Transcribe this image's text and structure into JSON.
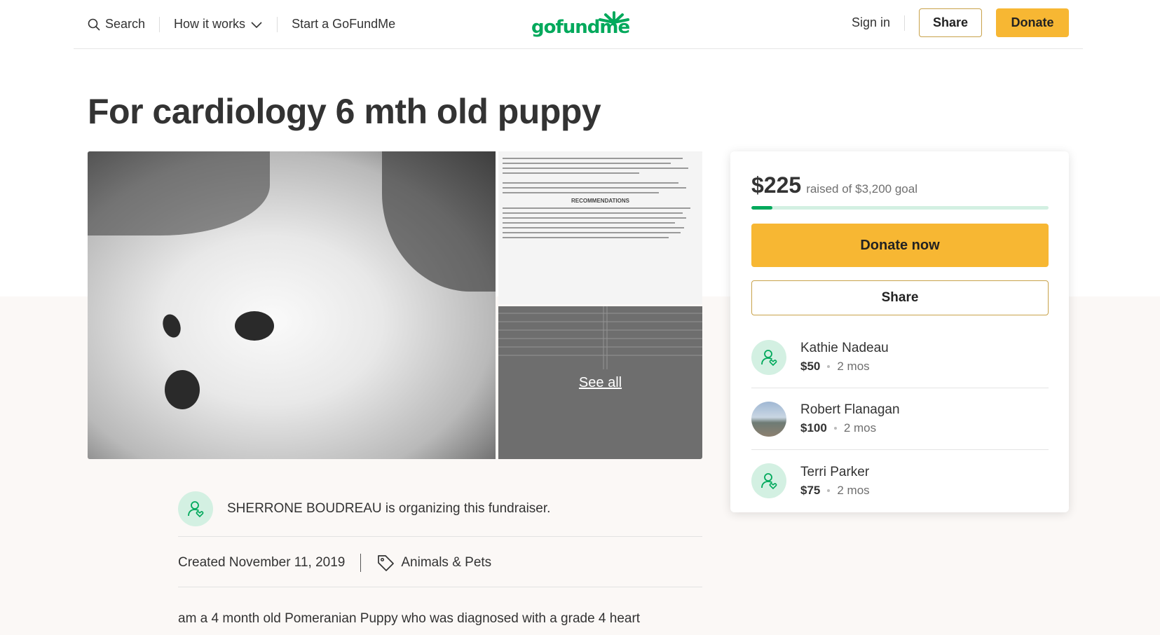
{
  "header": {
    "search_label": "Search",
    "how_it_works_label": "How it works",
    "start_label": "Start a GoFundMe",
    "logo_text": "gofundme",
    "signin_label": "Sign in",
    "share_label": "Share",
    "donate_label": "Donate"
  },
  "campaign": {
    "title": "For cardiology 6 mth old puppy",
    "see_all_label": "See all",
    "document_heading": "RECOMMENDATIONS",
    "organizer_text": "SHERRONE BOUDREAU is organizing this fundraiser.",
    "created": "Created November 11, 2019",
    "category": "Animals & Pets",
    "story_start": "am a 4 month old Pomeranian Puppy who was diagnosed with a grade 4 heart"
  },
  "donation_card": {
    "raised_amount": "$225",
    "goal_text": "raised of $3,200 goal",
    "progress_fraction": 0.07,
    "donate_now_label": "Donate now",
    "share_label": "Share",
    "donors": [
      {
        "name": "Kathie Nadeau",
        "amount": "$50",
        "time": "2 mos"
      },
      {
        "name": "Robert Flanagan",
        "amount": "$100",
        "time": "2 mos"
      },
      {
        "name": "Terri Parker",
        "amount": "$75",
        "time": "2 mos"
      }
    ]
  },
  "colors": {
    "brand_green": "#02a95c",
    "donate_yellow": "#f7b733",
    "light_green": "#d3f0e2"
  }
}
